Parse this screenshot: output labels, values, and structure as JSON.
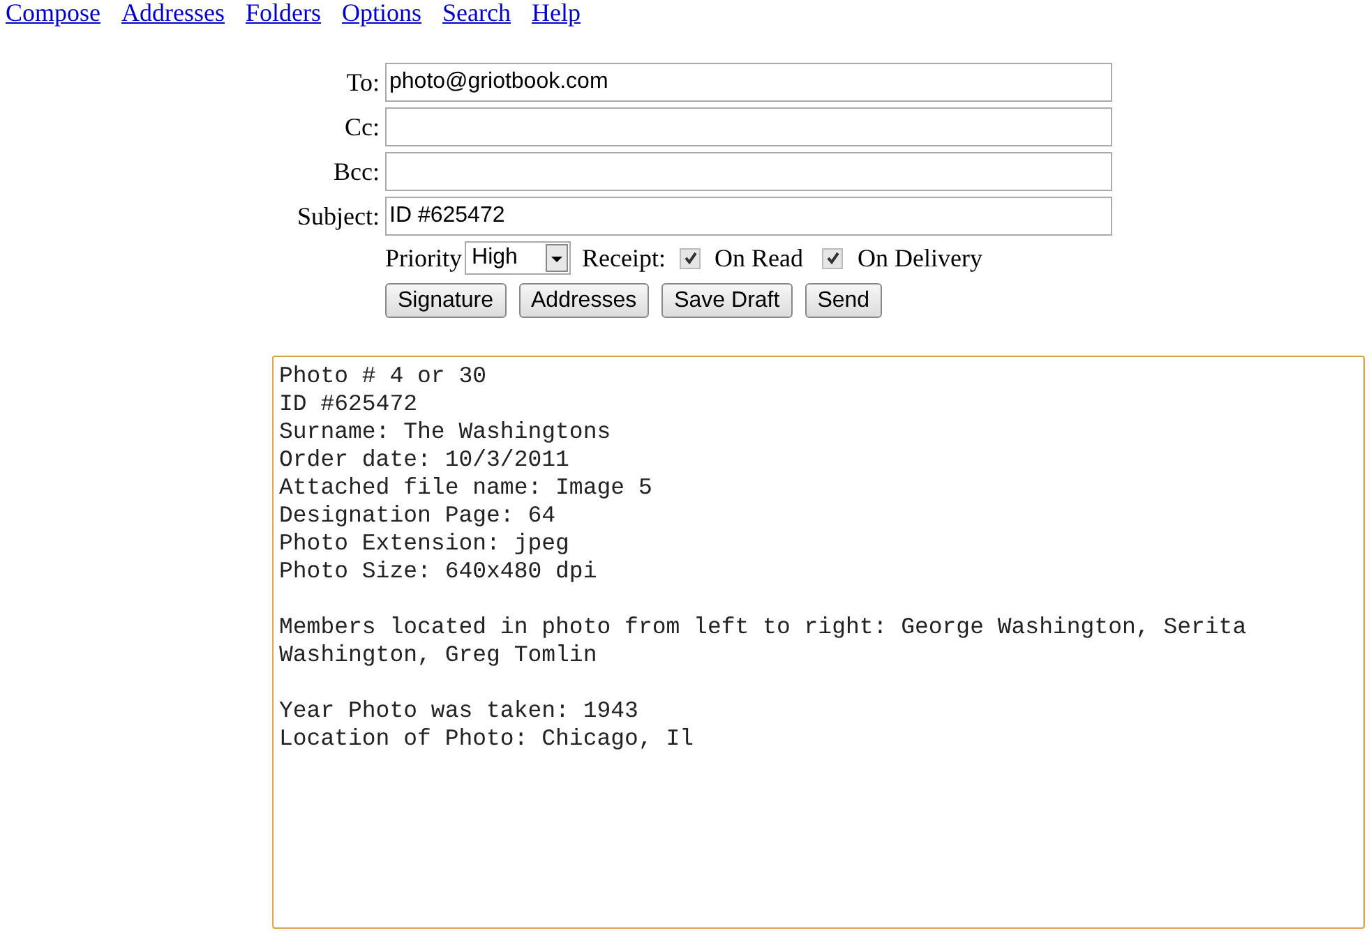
{
  "nav": [
    "Compose",
    "Addresses",
    "Folders",
    "Options",
    "Search",
    "Help"
  ],
  "fields": [
    {
      "label": "To:",
      "value": "photo@griotbook.com"
    },
    {
      "label": "Cc:"
    },
    {
      "label": "Bcc:"
    },
    {
      "label": "Subject:",
      "value": "ID #625472"
    }
  ],
  "priority": {
    "label": "Priority",
    "value": "High"
  },
  "receipt": {
    "label": "Receipt:",
    "options": [
      {
        "label": "On Read",
        "checked": true
      },
      {
        "label": "On Delivery",
        "checked": true
      }
    ]
  },
  "buttons": [
    "Signature",
    "Addresses",
    "Save Draft",
    "Send"
  ],
  "body": "Photo # 4 or 30\nID #625472\nSurname: The Washingtons\nOrder date: 10/3/2011\nAttached file name: Image 5\nDesignation Page: 64\nPhoto Extension: jpeg\nPhoto Size: 640x480 dpi\n\nMembers located in photo from left to right: George Washington, Serita\nWashington, Greg Tomlin\n\nYear Photo was taken: 1943\nLocation of Photo: Chicago, Il"
}
